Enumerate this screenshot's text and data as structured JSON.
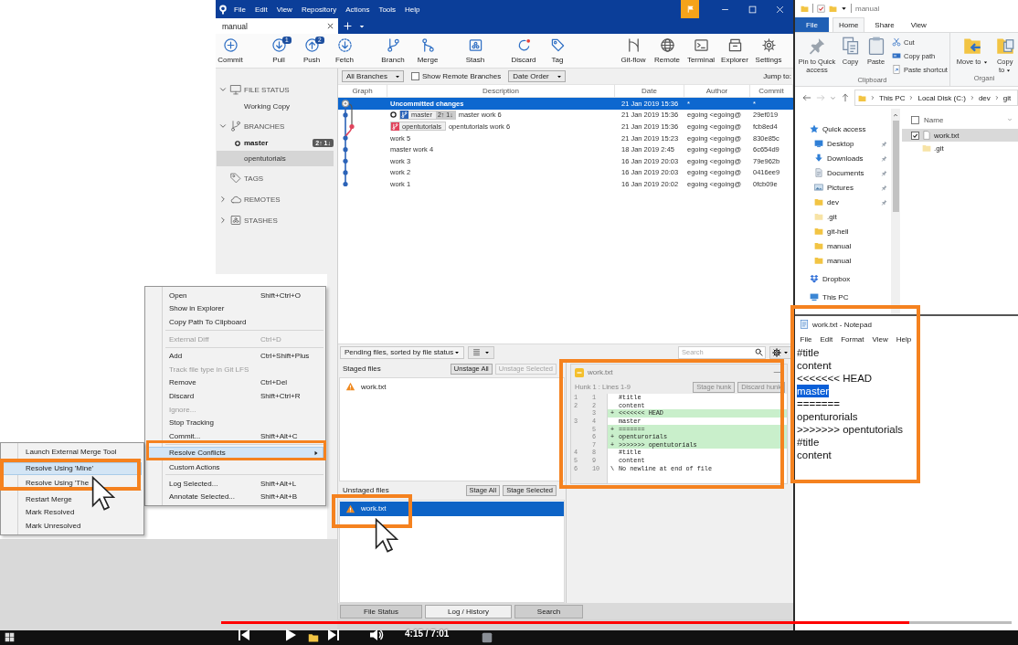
{
  "sourcetree": {
    "menu": [
      "File",
      "Edit",
      "View",
      "Repository",
      "Actions",
      "Tools",
      "Help"
    ],
    "tabs": [
      {
        "label": "manual",
        "selected": true
      }
    ],
    "toolbar_left": [
      {
        "label": "Commit"
      },
      {
        "label": "Pull",
        "badge": "1"
      },
      {
        "label": "Push",
        "badge": "2"
      },
      {
        "label": "Fetch"
      },
      {
        "label": "Branch"
      },
      {
        "label": "Merge"
      },
      {
        "label": "Stash"
      },
      {
        "label": "Discard"
      },
      {
        "label": "Tag"
      }
    ],
    "toolbar_right": [
      {
        "label": "Git-flow"
      },
      {
        "label": "Remote"
      },
      {
        "label": "Terminal"
      },
      {
        "label": "Explorer"
      },
      {
        "label": "Settings"
      }
    ],
    "sidebar": [
      {
        "label": "FILE STATUS",
        "expanded": true,
        "children": [
          {
            "label": "Working Copy",
            "selected": false,
            "current": false
          }
        ]
      },
      {
        "label": "BRANCHES",
        "expanded": true,
        "children": [
          {
            "label": "master",
            "selected": false,
            "current": true,
            "badge": "2↑ 1↓"
          },
          {
            "label": "opentutorials",
            "selected": true,
            "current": false
          }
        ]
      },
      {
        "label": "TAGS"
      },
      {
        "label": "REMOTES",
        "expanded": false
      },
      {
        "label": "STASHES",
        "expanded": false
      }
    ],
    "filters": {
      "branches": "All Branches",
      "show_remote": {
        "label": "Show Remote Branches",
        "checked": false
      },
      "order": "Date Order",
      "jump": "Jump to:"
    },
    "columns": [
      "Graph",
      "Description",
      "Date",
      "Author",
      "Commit"
    ],
    "commits": [
      {
        "kind": "uncommitted",
        "color": "#9a9a9a",
        "description": "Uncommitted changes",
        "date": "21 Jan 2019 15:36",
        "author": "*",
        "commit": "*",
        "selected": true
      },
      {
        "kind": "main",
        "color": "#2b63b8",
        "refs": [
          {
            "label": "master",
            "color": "#2b63b8",
            "current": true,
            "badge": "2↑ 1↓"
          }
        ],
        "description": "master work 6",
        "date": "21 Jan 2019 15:36",
        "author": "egoing <egoing@",
        "commit": "29ef019",
        "selected": false
      },
      {
        "kind": "branch",
        "color": "#e0445c",
        "refs": [
          {
            "label": "opentutorials",
            "color": "#e0445c",
            "current": false
          }
        ],
        "description": "opentutorials work 6",
        "date": "21 Jan 2019 15:36",
        "author": "egoing <egoing@",
        "commit": "fcb8ed4",
        "selected": false
      },
      {
        "kind": "main",
        "color": "#2b63b8",
        "description": "work 5",
        "date": "21 Jan 2019 15:23",
        "author": "egoing <egoing@",
        "commit": "830e85c",
        "selected": false
      },
      {
        "kind": "main",
        "color": "#2b63b8",
        "description": "master work 4",
        "date": "18 Jan 2019 2:45",
        "author": "egoing <egoing@",
        "commit": "6c654d9",
        "selected": false
      },
      {
        "kind": "main",
        "color": "#2b63b8",
        "description": "work 3",
        "date": "16 Jan 2019 20:03",
        "author": "egoing <egoing@",
        "commit": "79e962b",
        "selected": false
      },
      {
        "kind": "main",
        "color": "#2b63b8",
        "description": "work 2",
        "date": "16 Jan 2019 20:03",
        "author": "egoing <egoing@",
        "commit": "0416ee9",
        "selected": false
      },
      {
        "kind": "main",
        "color": "#2b63b8",
        "description": "work 1",
        "date": "16 Jan 2019 20:02",
        "author": "egoing <egoing@",
        "commit": "0fcb09e",
        "selected": false
      }
    ],
    "pending": {
      "sort": "Pending files, sorted by file status",
      "search": {
        "placeholder": "Search"
      }
    },
    "staged": {
      "title": "Staged files",
      "buttons": [
        {
          "label": "Unstage All",
          "disabled": false
        },
        {
          "label": "Unstage Selected",
          "disabled": true
        }
      ],
      "files": [
        {
          "name": "work.txt",
          "selected": false
        }
      ]
    },
    "unstaged": {
      "title": "Unstaged files",
      "buttons": [
        {
          "label": "Stage All",
          "disabled": false
        },
        {
          "label": "Stage Selected",
          "disabled": false
        }
      ],
      "files": [
        {
          "name": "work.txt",
          "selected": true
        }
      ]
    },
    "diff": {
      "file": "work.txt",
      "hunk": "Hunk 1 : Lines 1-9",
      "buttons": [
        "Stage hunk",
        "Discard hunk"
      ],
      "lines": [
        {
          "kind": "context",
          "old": "1",
          "new": "1",
          "text": "#title"
        },
        {
          "kind": "context",
          "old": "2",
          "new": "2",
          "text": "content"
        },
        {
          "kind": "added",
          "new": "3",
          "marker": "+",
          "text": "<<<<<<< HEAD"
        },
        {
          "kind": "context",
          "old": "3",
          "new": "4",
          "text": "master"
        },
        {
          "kind": "added",
          "new": "5",
          "marker": "+",
          "text": "======="
        },
        {
          "kind": "added",
          "new": "6",
          "marker": "+",
          "text": "openturorials"
        },
        {
          "kind": "added",
          "new": "7",
          "marker": "+",
          "text": ">>>>>>> opentutorials"
        },
        {
          "kind": "context",
          "old": "4",
          "new": "8",
          "text": "#title"
        },
        {
          "kind": "context",
          "old": "5",
          "new": "9",
          "text": "content"
        },
        {
          "kind": "note",
          "old": "6",
          "new": "10",
          "marker": "\\",
          "text": "No newline at end of file"
        }
      ]
    },
    "bottom_tabs": [
      {
        "label": "File Status",
        "selected": false
      },
      {
        "label": "Log / History",
        "selected": true
      },
      {
        "label": "Search",
        "selected": false
      }
    ]
  },
  "context_menu": {
    "items": [
      {
        "kind": "item",
        "label": "Open",
        "shortcut": "Shift+Ctrl+O",
        "disabled": false,
        "selected": false
      },
      {
        "kind": "item",
        "label": "Show in Explorer",
        "disabled": false,
        "selected": false
      },
      {
        "kind": "item",
        "label": "Copy Path To Clipboard",
        "disabled": false,
        "selected": false
      },
      {
        "kind": "separator"
      },
      {
        "kind": "item",
        "label": "External Diff",
        "shortcut": "Ctrl+D",
        "disabled": true,
        "selected": false
      },
      {
        "kind": "separator"
      },
      {
        "kind": "item",
        "label": "Add",
        "shortcut": "Ctrl+Shift+Plus",
        "disabled": false,
        "selected": false
      },
      {
        "kind": "item",
        "label": "Track file type in Git LFS",
        "disabled": true,
        "selected": false
      },
      {
        "kind": "item",
        "label": "Remove",
        "shortcut": "Ctrl+Del",
        "disabled": false,
        "selected": false
      },
      {
        "kind": "item",
        "label": "Discard",
        "shortcut": "Shift+Ctrl+R",
        "disabled": false,
        "selected": false
      },
      {
        "kind": "item",
        "label": "Ignore...",
        "disabled": true,
        "selected": false
      },
      {
        "kind": "item",
        "label": "Stop Tracking",
        "disabled": false,
        "selected": false
      },
      {
        "kind": "item",
        "label": "Commit...",
        "shortcut": "Shift+Alt+C",
        "disabled": false,
        "selected": false
      },
      {
        "kind": "separator"
      },
      {
        "kind": "submenu",
        "label": "Resolve Conflicts",
        "disabled": false,
        "selected": true
      },
      {
        "kind": "item",
        "label": "Custom Actions",
        "disabled": false,
        "selected": false
      },
      {
        "kind": "separator"
      },
      {
        "kind": "item",
        "label": "Log Selected...",
        "shortcut": "Shift+Alt+L",
        "disabled": false,
        "selected": false
      },
      {
        "kind": "item",
        "label": "Annotate Selected...",
        "shortcut": "Shift+Alt+B",
        "disabled": false,
        "selected": false
      }
    ]
  },
  "submenu": {
    "items": [
      {
        "kind": "item",
        "label": "Launch External Merge Tool",
        "disabled": false,
        "selected": false
      },
      {
        "kind": "separator"
      },
      {
        "kind": "item",
        "label": "Resolve Using 'Mine'",
        "disabled": false,
        "selected": true
      },
      {
        "kind": "item",
        "label": "Resolve Using 'The",
        "disabled": false,
        "selected": false
      },
      {
        "kind": "separator"
      },
      {
        "kind": "item",
        "label": "Restart Merge",
        "disabled": false,
        "selected": false
      },
      {
        "kind": "item",
        "label": "Mark Resolved",
        "disabled": false,
        "selected": false
      },
      {
        "kind": "item",
        "label": "Mark Unresolved",
        "disabled": false,
        "selected": false
      }
    ]
  },
  "explorer": {
    "title": "manual",
    "ribbon_tabs": [
      {
        "label": "File",
        "kind": "menu",
        "selected": false
      },
      {
        "label": "Home",
        "kind": "tab",
        "selected": true
      },
      {
        "label": "Share",
        "kind": "tab",
        "selected": false
      },
      {
        "label": "View",
        "kind": "tab",
        "selected": false
      }
    ],
    "groups": [
      {
        "label": "Clipboard",
        "large": [
          {
            "label": "Pin to Quick access",
            "menu": false
          },
          {
            "label": "Copy",
            "menu": false
          },
          {
            "label": "Paste",
            "menu": false
          }
        ],
        "small": [
          {
            "label": "Cut"
          },
          {
            "label": "Copy path"
          },
          {
            "label": "Paste shortcut"
          }
        ]
      },
      {
        "label": "Organi",
        "large": [
          {
            "label": "Move to",
            "menu": true
          },
          {
            "label": "Copy to",
            "menu": true
          }
        ]
      }
    ],
    "path": [
      "This PC",
      "Local Disk (C:)",
      "dev",
      "git"
    ],
    "nav": [
      {
        "label": "Quick access",
        "kind": "star",
        "children": [
          {
            "label": "Desktop",
            "kind": "desktop",
            "pinned": true
          },
          {
            "label": "Downloads",
            "kind": "download",
            "pinned": true
          },
          {
            "label": "Documents",
            "kind": "document",
            "pinned": true
          },
          {
            "label": "Pictures",
            "kind": "picture",
            "pinned": true
          },
          {
            "label": "dev",
            "kind": "folder",
            "pinned": true
          },
          {
            "label": ".git",
            "kind": "hidden-folder",
            "pinned": false
          },
          {
            "label": "git-hell",
            "kind": "folder",
            "pinned": false
          },
          {
            "label": "manual",
            "kind": "folder",
            "pinned": false
          },
          {
            "label": "manual",
            "kind": "folder",
            "pinned": false
          }
        ]
      },
      {
        "label": "Dropbox",
        "kind": "dropbox"
      },
      {
        "label": "This PC",
        "kind": "computer"
      }
    ],
    "column": "Name",
    "files": [
      {
        "name": "work.txt",
        "kind": "file",
        "selected": true,
        "checked": true
      },
      {
        "name": ".git",
        "kind": "hidden-folder",
        "selected": false,
        "checked": false
      }
    ]
  },
  "notepad": {
    "title": "work.txt - Notepad",
    "menu": [
      "File",
      "Edit",
      "Format",
      "View",
      "Help"
    ],
    "lines": [
      {
        "text": "#title",
        "selected": false
      },
      {
        "text": "content",
        "selected": false
      },
      {
        "text": "<<<<<<< HEAD",
        "selected": false
      },
      {
        "text": "master",
        "selected": true
      },
      {
        "text": "=======",
        "selected": false
      },
      {
        "text": "openturorials",
        "selected": false
      },
      {
        "text": ">>>>>>> opentutorials",
        "selected": false
      },
      {
        "text": "#title",
        "selected": false
      },
      {
        "text": "content",
        "selected": false
      }
    ]
  },
  "player": {
    "time": "4:15 / 7:01",
    "level": 0.87
  }
}
